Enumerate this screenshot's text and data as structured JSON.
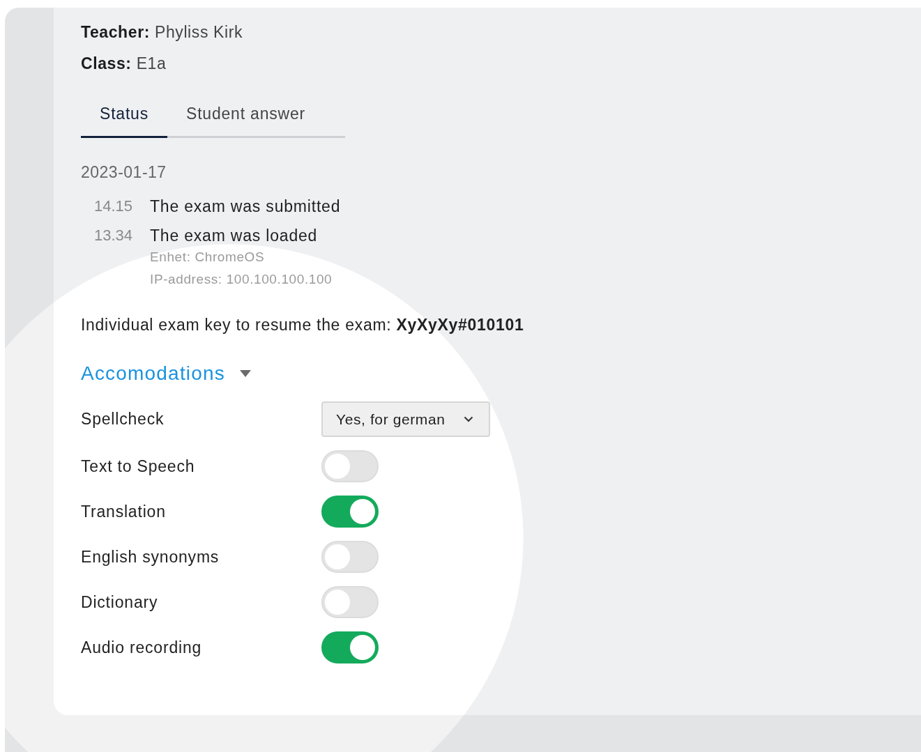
{
  "teacher": {
    "label": "Teacher:",
    "value": "Phyliss Kirk"
  },
  "class": {
    "label": "Class:",
    "value": "E1a"
  },
  "tabs": [
    {
      "label": "Status",
      "selected": true
    },
    {
      "label": "Student answer",
      "selected": false
    }
  ],
  "log": {
    "date": "2023-01-17",
    "events": [
      {
        "time": "14.15",
        "text": "The exam was submitted"
      },
      {
        "time": "13.34",
        "text": "The exam was loaded",
        "details": [
          "Enhet: ChromeOS",
          "IP-address: 100.100.100.100"
        ]
      }
    ]
  },
  "exam_key": "Individual exam key to resume the exam: **XyXyXy#010101**",
  "accommodations": {
    "title": "Accomodations",
    "expanded": true,
    "items": [
      {
        "kind": "select",
        "label": "Spellcheck",
        "value": "Yes, for german"
      },
      {
        "kind": "toggle",
        "label": "Text to Speech",
        "on": false
      },
      {
        "kind": "toggle",
        "label": "Translation",
        "on": true
      },
      {
        "kind": "toggle",
        "label": "English synonyms",
        "on": false
      },
      {
        "kind": "toggle",
        "label": "Dictionary",
        "on": false
      },
      {
        "kind": "toggle",
        "label": "Audio recording",
        "on": true
      }
    ]
  }
}
